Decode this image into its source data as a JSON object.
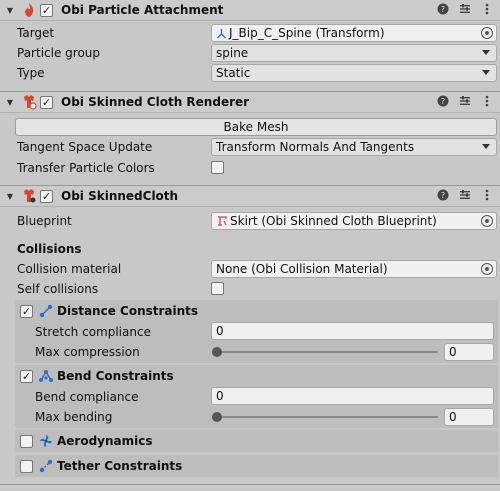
{
  "attachment": {
    "title": "Obi Particle Attachment",
    "target_label": "Target",
    "target_value": "J_Bip_C_Spine (Transform)",
    "particle_group_label": "Particle group",
    "particle_group_value": "spine",
    "type_label": "Type",
    "type_value": "Static"
  },
  "renderer": {
    "title": "Obi Skinned Cloth Renderer",
    "bake_button": "Bake Mesh",
    "tangent_label": "Tangent Space Update",
    "tangent_value": "Transform Normals And Tangents",
    "transfer_label": "Transfer Particle Colors"
  },
  "cloth": {
    "title": "Obi SkinnedCloth",
    "blueprint_label": "Blueprint",
    "blueprint_value": "Skirt (Obi Skinned Cloth Blueprint)",
    "collisions_heading": "Collisions",
    "collision_material_label": "Collision material",
    "collision_material_value": "None (Obi Collision Material)",
    "self_collisions_label": "Self collisions",
    "distance": {
      "title": "Distance Constraints",
      "enabled": true,
      "stretch_label": "Stretch compliance",
      "stretch_value": "0",
      "compression_label": "Max compression",
      "compression_value": "0"
    },
    "bend": {
      "title": "Bend Constraints",
      "enabled": true,
      "compliance_label": "Bend compliance",
      "compliance_value": "0",
      "max_bending_label": "Max bending",
      "max_bending_value": "0"
    },
    "aerodynamics": {
      "title": "Aerodynamics",
      "enabled": false
    },
    "tether": {
      "title": "Tether Constraints",
      "enabled": false
    }
  },
  "icons": {
    "help": "help-icon",
    "presets": "presets-icon",
    "menu": "context-menu-icon"
  },
  "colors": {
    "accent_blue": "#2b6fc9",
    "component_red": "#d8442c"
  }
}
